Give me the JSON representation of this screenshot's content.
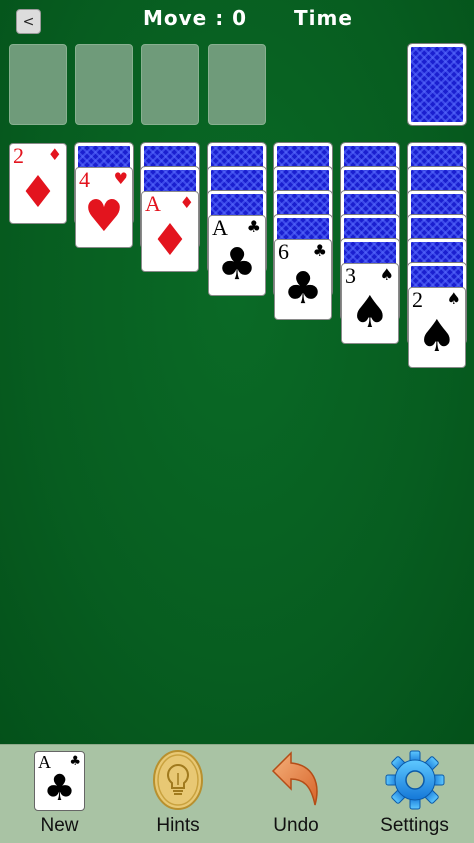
{
  "header": {
    "back_label": "<",
    "move_label": "Move : 0",
    "time_label": "Time"
  },
  "tableau": [
    {
      "face_down": 0,
      "face_up": [
        {
          "rank": "2",
          "suit": "♦",
          "color": "red"
        }
      ]
    },
    {
      "face_down": 1,
      "face_up": [
        {
          "rank": "4",
          "suit": "♥",
          "color": "red"
        }
      ]
    },
    {
      "face_down": 2,
      "face_up": [
        {
          "rank": "A",
          "suit": "♦",
          "color": "red"
        }
      ]
    },
    {
      "face_down": 3,
      "face_up": [
        {
          "rank": "A",
          "suit": "♣",
          "color": "black"
        }
      ]
    },
    {
      "face_down": 4,
      "face_up": [
        {
          "rank": "6",
          "suit": "♣",
          "color": "black"
        }
      ]
    },
    {
      "face_down": 5,
      "face_up": [
        {
          "rank": "3",
          "suit": "♠",
          "color": "black"
        }
      ]
    },
    {
      "face_down": 6,
      "face_up": [
        {
          "rank": "2",
          "suit": "♠",
          "color": "black"
        }
      ]
    }
  ],
  "colors": {
    "felt": "#065a1f",
    "card_back": "#1a1fd0",
    "red_suit": "#e3141e",
    "toolbar": "#a9c3a4"
  },
  "toolbar": {
    "new": {
      "label": "New",
      "icon": "card-ace-clubs-icon",
      "rank": "A",
      "suit": "♣"
    },
    "hints": {
      "label": "Hints",
      "icon": "lightbulb-icon"
    },
    "undo": {
      "label": "Undo",
      "icon": "undo-arrow-icon"
    },
    "settings": {
      "label": "Settings",
      "icon": "gear-icon"
    }
  }
}
